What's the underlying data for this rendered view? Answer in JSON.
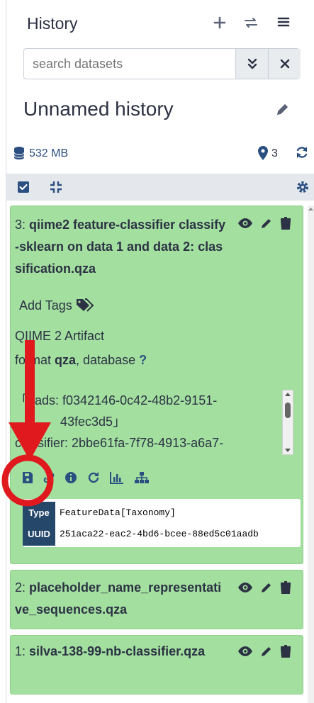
{
  "header": {
    "title": "History"
  },
  "search": {
    "placeholder": "search datasets"
  },
  "history": {
    "name": "Unnamed history",
    "size": "532 MB",
    "count": "3"
  },
  "datasets": [
    {
      "hid": "3:",
      "name": "qiime2 feature-classifier classify-sklearn on data 1 and data 2: classification.qza",
      "tags_label": "Add Tags",
      "artifact_label": "QIIME 2 Artifact",
      "format_prefix": "format",
      "format_value": "qza",
      "database_label": ", database",
      "database_value": "?",
      "peek_line1": "「eads: f0342146-0c42-48b2-9151-",
      "peek_line2": "43fec3d5」",
      "peek_line3": "classifier: 2bbe61fa-7f78-4913-a6a7-",
      "meta_type_key": "Type",
      "meta_type_value": "FeatureData[Taxonomy]",
      "meta_uuid_key": "UUID",
      "meta_uuid_value": "251aca22-eac2-4bd6-bcee-88ed5c01aadb"
    },
    {
      "hid": "2:",
      "name": "placeholder_name_representative_sequences.qza"
    },
    {
      "hid": "1:",
      "name": "silva-138-99-nb-classifier.qza"
    }
  ],
  "colors": {
    "ok_state": "#a3e0a0",
    "annotation_red": "#e0191e"
  }
}
